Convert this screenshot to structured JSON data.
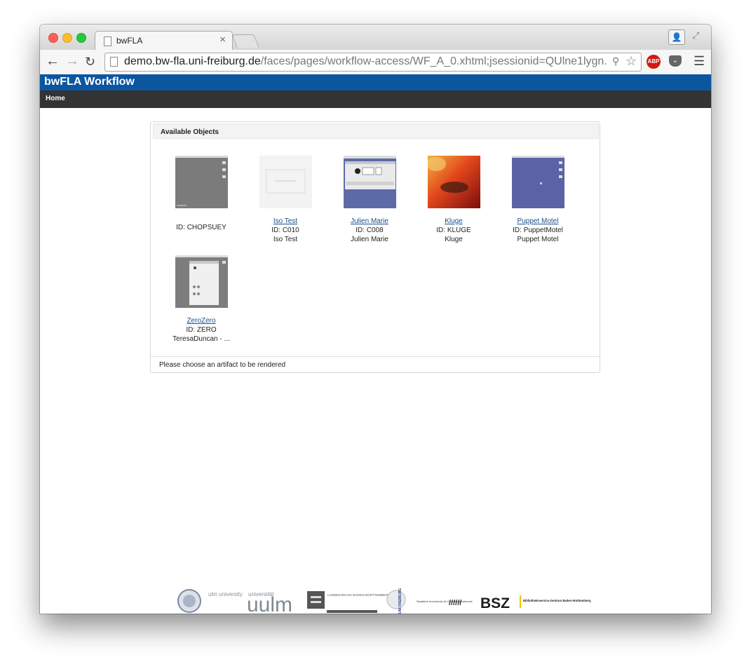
{
  "browser": {
    "tab_title": "bwFLA",
    "tab_close": "×",
    "url_host": "demo.bw-fla.uni-freiburg.de",
    "url_rest": "/faces/pages/workflow-access/WF_A_0.xhtml;jsessionid=QUlne1lygn...",
    "abp_label": "ABP"
  },
  "app": {
    "title": "bwFLA Workflow",
    "nav": {
      "home": "Home"
    }
  },
  "panel": {
    "title": "Available Objects",
    "footer": "Please choose an artifact to be rendered",
    "items": [
      {
        "link": "",
        "id": "ID: CHOPSUEY",
        "desc": "",
        "thumb": "grey-desktop"
      },
      {
        "link": "Iso Test",
        "id": "ID: C010",
        "desc": "Iso Test",
        "thumb": "light-placeholder"
      },
      {
        "link": "Julien Marie",
        "id": "ID: C008",
        "desc": "Julien Marie",
        "thumb": "mac-window"
      },
      {
        "link": "Kluge",
        "id": "ID: KLUGE",
        "desc": "Kluge",
        "thumb": "abstract-orange"
      },
      {
        "link": "Puppet Motel",
        "id": "ID: PuppetMotel",
        "desc": "Puppet Motel",
        "thumb": "purple-desktop"
      },
      {
        "link": "ZeroZero",
        "id": "ID: ZERO",
        "desc": "TeresaDuncan - ...",
        "thumb": "grey-window"
      }
    ]
  },
  "logos": {
    "ulm_small": "ulm university",
    "ulm_univ": "universität",
    "ulm_big": "uulm",
    "landesarchiv": "LANDESARCHIV BADEN-WÜRTTEMBERG",
    "freiburg": "UNI FREIBURG",
    "hfg": "Staatliche Hochschule für Gestaltung Karlsruhe",
    "hfg_mark": "//////",
    "bsz": "BSZ",
    "bsz_text": "Bibliotheksservice-Zentrum Baden-Württemberg"
  }
}
